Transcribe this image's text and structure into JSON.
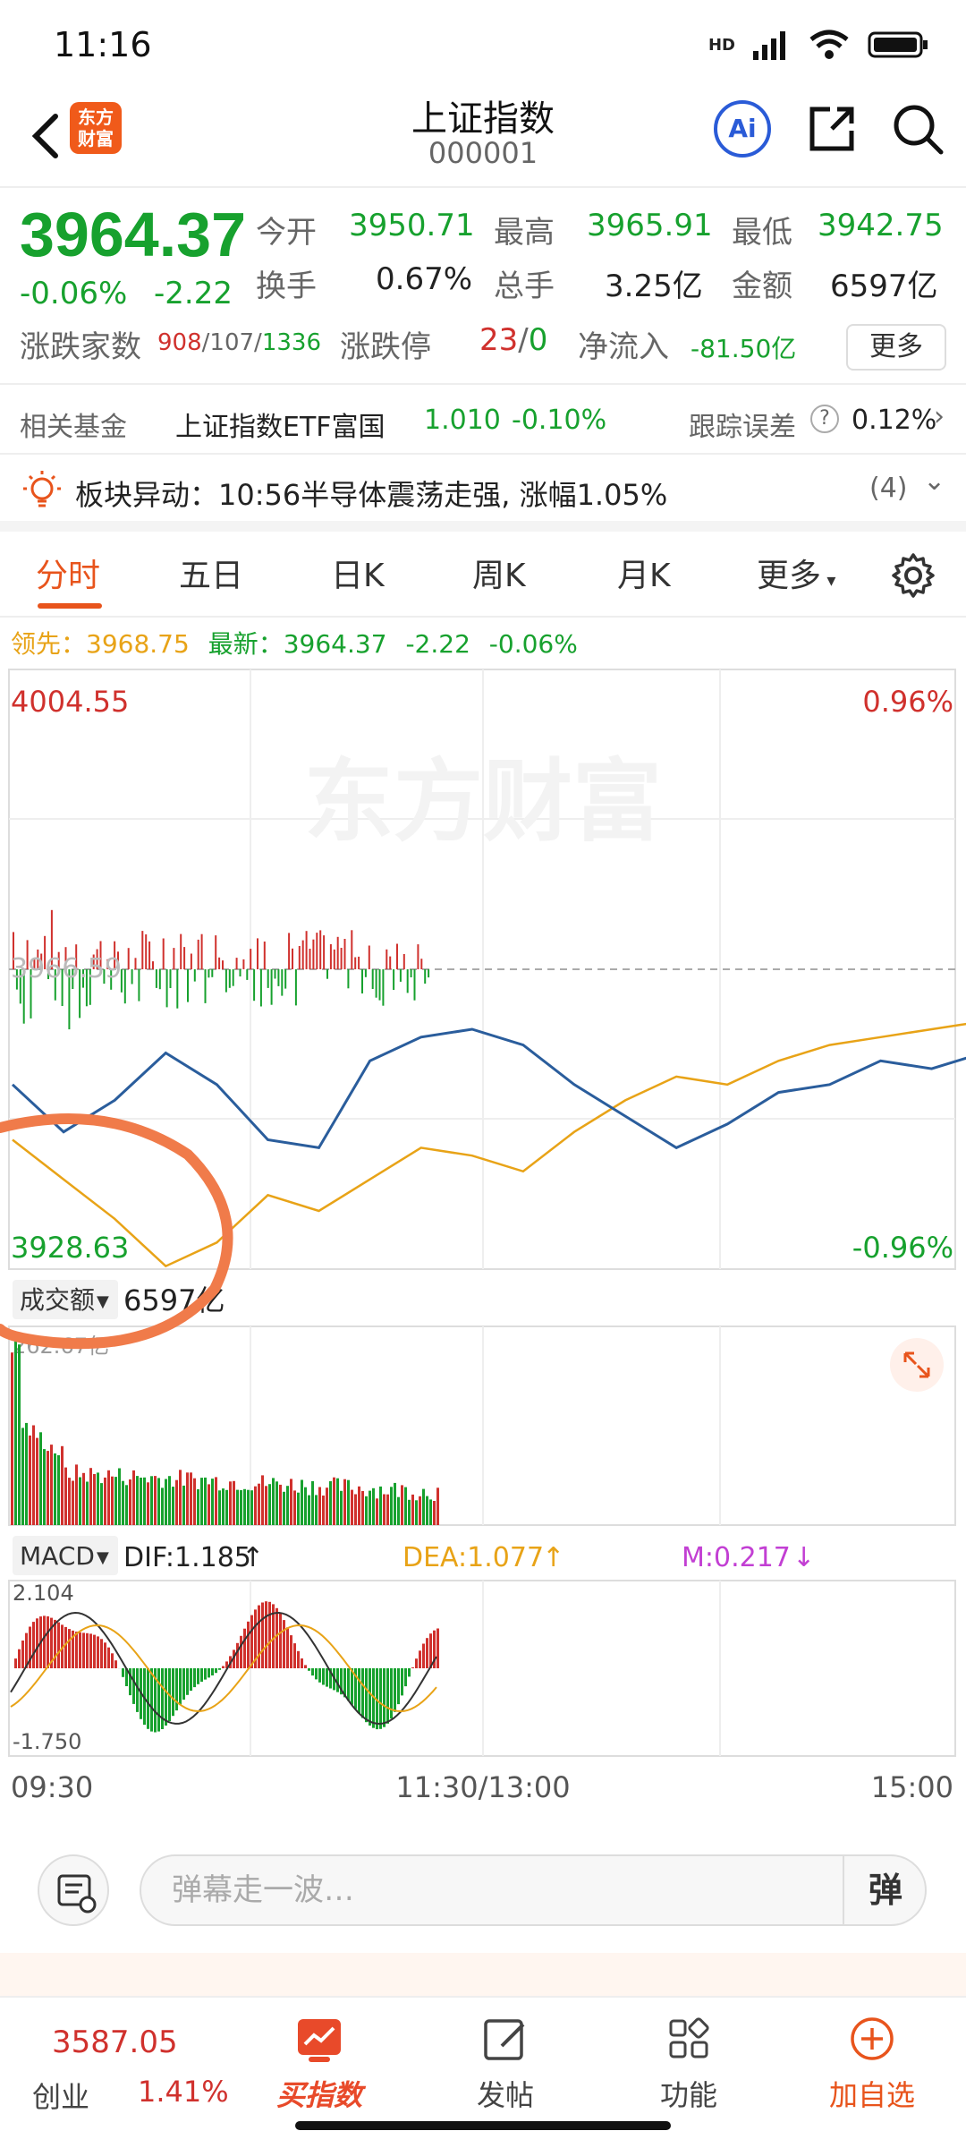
{
  "status": {
    "time": "11:16",
    "network": "HD",
    "net2": "4G"
  },
  "header": {
    "logo_line1": "东方",
    "logo_line2": "财富",
    "title": "上证指数",
    "code": "000001",
    "ai_label": "Ai"
  },
  "quote": {
    "price": "3964.37",
    "pct": "-0.06%",
    "chg": "-2.22",
    "open_label": "今开",
    "open": "3950.71",
    "high_label": "最高",
    "high": "3965.91",
    "low_label": "最低",
    "low": "3942.75",
    "turnover_label": "换手",
    "turnover": "0.67%",
    "volume_label": "总手",
    "volume": "3.25亿",
    "amount_label": "金额",
    "amount": "6597亿",
    "adv_label": "涨跌家数",
    "adv_up": "908",
    "adv_flat": "107",
    "adv_down": "1336",
    "limit_label": "涨跌停",
    "limit_up": "23",
    "limit_down": "0",
    "flow_label": "净流入",
    "flow": "-81.50亿",
    "more": "更多"
  },
  "fund": {
    "label": "相关基金",
    "name": "上证指数ETF富国",
    "price": "1.010",
    "pct": "-0.10%",
    "err_label": "跟踪误差",
    "err": "0.12%"
  },
  "notice": {
    "text": "板块异动：10:56半导体震荡走强, 涨幅1.05%",
    "count": "(4)"
  },
  "tabs": [
    "分时",
    "五日",
    "日K",
    "周K",
    "月K",
    "更多"
  ],
  "info": {
    "lead_label": "领先：",
    "lead": "3968.75",
    "latest_label": "最新：",
    "latest": "3964.37",
    "chg": "-2.22",
    "pct": "-0.06%"
  },
  "chart_data": [
    {
      "type": "line",
      "y_top_label": "4004.55",
      "y_bottom_label": "3928.63",
      "y_ref_label": "3966.59",
      "pct_top_label": "0.96%",
      "pct_bottom_label": "-0.96%",
      "watermark": "东方财富",
      "ylim": [
        3928.63,
        4004.55
      ],
      "x_ticks": [
        "09:30",
        "11:30/13:00",
        "15:00"
      ],
      "series": [
        {
          "values": [
            3952,
            3946,
            3950,
            3956,
            3952,
            3945,
            3944,
            3955,
            3958,
            3959,
            3957,
            3952,
            3948,
            3944,
            3947,
            3951,
            3952,
            3955,
            3954,
            3956,
            3957,
            3955,
            3953,
            3956,
            3958,
            3957,
            3960,
            3959,
            3957,
            3961,
            3963,
            3964,
            3962,
            3957,
            3961,
            3964,
            3965,
            3964
          ]
        },
        {
          "values": [
            3945,
            3940,
            3935,
            3929,
            3932,
            3938,
            3936,
            3940,
            3944,
            3943,
            3941,
            3946,
            3950,
            3953,
            3952,
            3955,
            3957,
            3958,
            3959,
            3960,
            3958,
            3961,
            3962,
            3961,
            3963,
            3962,
            3964,
            3962,
            3964,
            3965,
            3963,
            3966,
            3965,
            3963,
            3965,
            3966,
            3968,
            3968.75
          ]
        }
      ]
    },
    {
      "type": "bar",
      "title": "成交额",
      "total_label": "6597亿",
      "max_label": "262.67亿"
    },
    {
      "type": "bar",
      "title": "MACD",
      "dif_label": "DIF:1.185",
      "dea_label": "DEA:1.077",
      "m_label": "M:0.217",
      "y_top_label": "2.104",
      "y_bottom_label": "-1.750",
      "ylim": [
        -1.75,
        2.104
      ]
    }
  ],
  "danmu": {
    "placeholder": "弹幕走一波…",
    "toggle": "弹"
  },
  "bottombar": {
    "index_value": "3587.05",
    "index_name": "创业",
    "index_pct": "1.41%",
    "buy": "买指数",
    "post": "发帖",
    "func": "功能",
    "add": "加自选"
  },
  "colors": {
    "up": "#d0312d",
    "down": "#17a12e",
    "accent": "#e8541c",
    "lead": "#e8a317",
    "price": "#2a5d9c"
  }
}
